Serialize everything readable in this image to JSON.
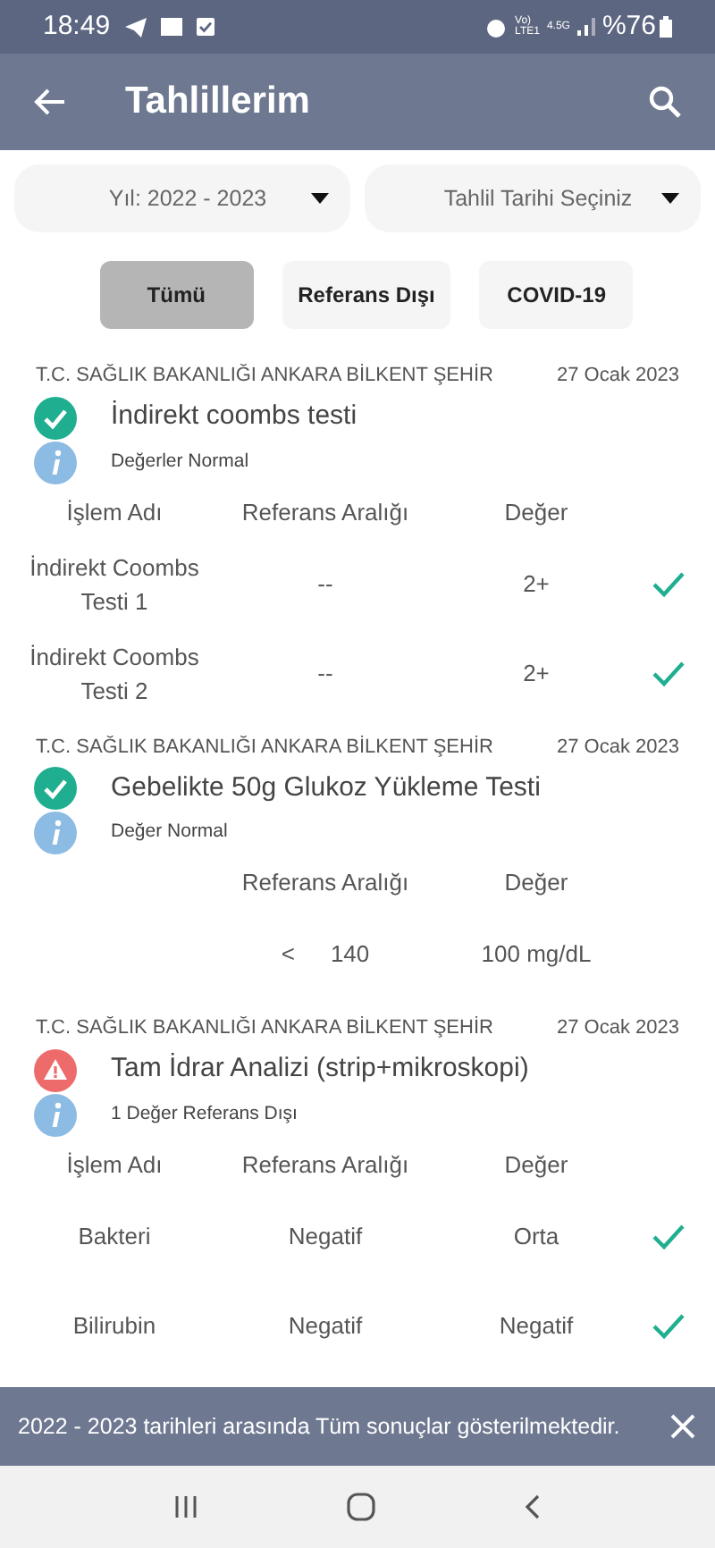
{
  "status_bar": {
    "time": "18:49",
    "network_top": "Vo)",
    "network_bottom": "LTE1",
    "network_type": "4.5G",
    "battery": "%76"
  },
  "app_bar": {
    "title": "Tahlillerim"
  },
  "dropdowns": [
    {
      "value": "Yıl: 2022 - 2023"
    },
    {
      "value": "Tahlil Tarihi Seçiniz"
    }
  ],
  "filters": [
    {
      "label": "Tümü",
      "selected": true
    },
    {
      "label": "Referans Dışı",
      "selected": false
    },
    {
      "label": "COVID-19",
      "selected": false
    }
  ],
  "results": [
    {
      "hospital": "T.C. SAĞLIK BAKANLIĞI ANKARA BİLKENT ŞEHİR",
      "date": "27 Ocak 2023",
      "kind": "normal",
      "title": "İndirekt coombs testi",
      "info": "Değerler Normal",
      "columns": {
        "name": "İşlem Adı",
        "range": "Referans Aralığı",
        "value": "Değer"
      },
      "rows": [
        {
          "name": "İndirekt Coombs Testi 1",
          "range": "--",
          "value": "2+",
          "checked": true
        },
        {
          "name": "İndirekt Coombs Testi 2",
          "range": "--",
          "value": "2+",
          "checked": true
        }
      ]
    },
    {
      "hospital": "T.C. SAĞLIK BAKANLIĞI ANKARA BİLKENT ŞEHİR",
      "date": "27 Ocak 2023",
      "kind": "normal",
      "title": "Gebelikte 50g Glukoz Yükleme Testi",
      "info": "Değer Normal",
      "columns": {
        "range": "Referans Aralığı",
        "value": "Değer"
      },
      "rows": [
        {
          "comparator": "<",
          "range": "140",
          "value": "100 mg/dL",
          "checked": false
        }
      ]
    },
    {
      "hospital": "T.C. SAĞLIK BAKANLIĞI ANKARA BİLKENT ŞEHİR",
      "date": "27 Ocak 2023",
      "kind": "warning",
      "title": "Tam İdrar Analizi (strip+mikroskopi)",
      "info": "1 Değer Referans Dışı",
      "columns": {
        "name": "İşlem Adı",
        "range": "Referans Aralığı",
        "value": "Değer"
      },
      "rows": [
        {
          "name": "Bakteri",
          "range": "Negatif",
          "value": "Orta",
          "checked": true
        },
        {
          "name": "Bilirubin",
          "range": "Negatif",
          "value": "Negatif",
          "checked": true
        }
      ]
    }
  ],
  "snackbar": {
    "message": "2022 - 2023 tarihleri arasında Tüm sonuçlar gösterilmektedir."
  }
}
